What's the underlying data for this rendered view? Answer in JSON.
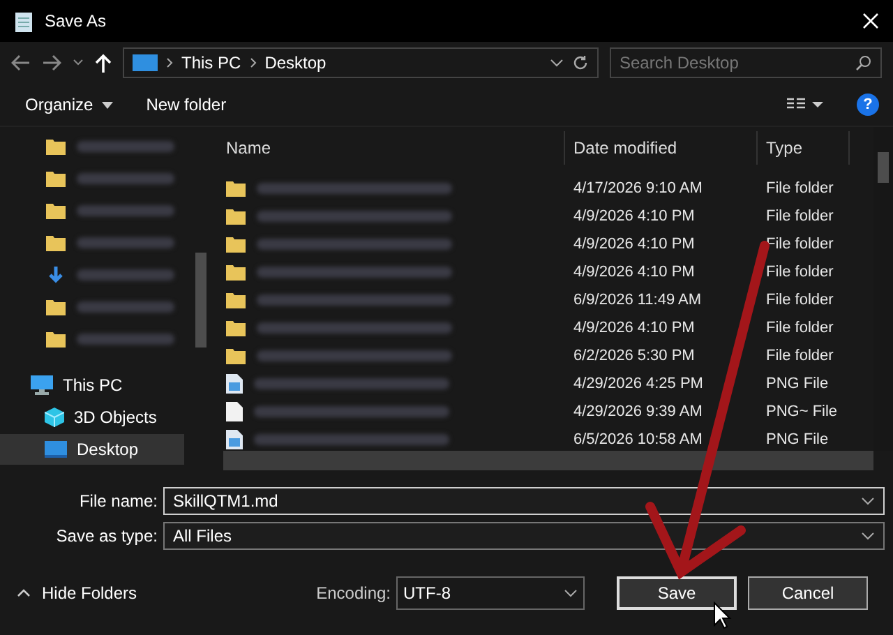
{
  "window": {
    "title": "Save As"
  },
  "nav": {
    "path": [
      "This PC",
      "Desktop"
    ],
    "search_placeholder": "Search Desktop"
  },
  "toolbar": {
    "organize": "Organize",
    "new_folder": "New folder",
    "help": "?"
  },
  "sidebar": {
    "quick_access": [
      {
        "kind": "folder"
      },
      {
        "kind": "folder"
      },
      {
        "kind": "folder"
      },
      {
        "kind": "folder"
      },
      {
        "kind": "download"
      },
      {
        "kind": "folder"
      },
      {
        "kind": "folder"
      }
    ],
    "tree": [
      {
        "label": "This PC",
        "kind": "pc",
        "selected": false,
        "children": [
          {
            "label": "3D Objects",
            "kind": "cube",
            "selected": false
          },
          {
            "label": "Desktop",
            "kind": "desktop",
            "selected": true
          }
        ]
      }
    ]
  },
  "table": {
    "columns": [
      "Name",
      "Date modified",
      "Type"
    ],
    "rows": [
      {
        "kind": "folder",
        "date": "4/17/2026 9:10 AM",
        "type": "File folder"
      },
      {
        "kind": "folder",
        "date": "4/9/2026 4:10 PM",
        "type": "File folder"
      },
      {
        "kind": "folder",
        "date": "4/9/2026 4:10 PM",
        "type": "File folder"
      },
      {
        "kind": "folder",
        "date": "4/9/2026 4:10 PM",
        "type": "File folder"
      },
      {
        "kind": "folder",
        "date": "6/9/2026 11:49 AM",
        "type": "File folder"
      },
      {
        "kind": "folder",
        "date": "4/9/2026 4:10 PM",
        "type": "File folder"
      },
      {
        "kind": "folder",
        "date": "6/2/2026 5:30 PM",
        "type": "File folder"
      },
      {
        "kind": "image",
        "date": "4/29/2026 4:25 PM",
        "type": "PNG File"
      },
      {
        "kind": "file",
        "date": "4/29/2026 9:39 AM",
        "type": "PNG~ File"
      },
      {
        "kind": "image",
        "date": "6/5/2026 10:58 AM",
        "type": "PNG File"
      }
    ]
  },
  "form": {
    "file_name_label": "File name:",
    "file_name": "SkillQTM1.md",
    "type_label": "Save as type:",
    "type": "All Files"
  },
  "footer": {
    "hide_folders": "Hide Folders",
    "encoding_label": "Encoding:",
    "encoding": "UTF-8",
    "buttons": [
      "Save",
      "Cancel"
    ]
  }
}
